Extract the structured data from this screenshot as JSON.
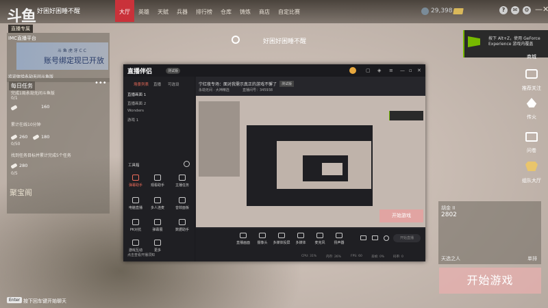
{
  "topbar": {
    "logo": "斗鱼",
    "logo_sub": "直播专属",
    "room_title": "好困好困睡不醒",
    "nav": [
      "大厅",
      "英雄",
      "天赋",
      "兵器",
      "排行榜",
      "仓库",
      "铸炼",
      "商店",
      "自定比赛"
    ],
    "active_nav": "大厅",
    "coins": "29,398",
    "icons": [
      "help-icon",
      "mail-icon",
      "settings-icon"
    ],
    "win_controls": [
      "—",
      "✕"
    ]
  },
  "left": {
    "banner_title": "IMC直播平台",
    "banner_small": "斗 鱼   虎 牙   C C",
    "banner_big": "账号绑定现已开放",
    "banner_caption": "欢迎体验永劫无间斗鱼版",
    "tasks_title": "每日任务",
    "tasks_more": "•••",
    "task_lines": [
      "完成1局永劫无间斗鱼版",
      "累计在线10分钟",
      "累计击败10名",
      "0/50",
      "找到任务目标并累计完成5个任务",
      "0/5"
    ],
    "task_nums": [
      "160",
      "260",
      "180",
      "280"
    ],
    "task_counts": [
      "0/1",
      "0/50",
      "0/5"
    ],
    "treasury": "聚宝阁"
  },
  "center": {
    "caption": "好困好困睡不醒"
  },
  "nvidia": {
    "text": "按下 Alt+Z，使用 GeForce Experience 游戏内覆盖"
  },
  "right": {
    "items": [
      "商城",
      "推荐关注",
      "传火",
      "问卷",
      "组队大厅"
    ],
    "party_label": "胡金 II",
    "party_score": "2802",
    "party_name": "天选之人",
    "party_mode": "单排",
    "start": "开始游戏",
    "enter_key": "Enter",
    "enter_text": "按下回车键开始聊天"
  },
  "stream": {
    "app": "直播伴侣",
    "badge": "测试版",
    "subtitle": "宁红夜专场：面对我需示真正的游戏不懈了",
    "room_info": "永劫无间 · 大神精选",
    "id": "直播间号：345938",
    "tabs": [
      "场景列表",
      "直播",
      "可选设"
    ],
    "scenes": [
      "直播画面 1",
      "直播画面 2",
      "Wonders",
      "游戏 1"
    ],
    "tools_title": "工具箱",
    "tools": [
      "弹幕助手",
      "观看助手",
      "主播任务",
      "电脑直播",
      "多人连麦",
      "音效面板",
      "PK对抗",
      "弹幕展",
      "数据助手",
      "游戏互动",
      "更多"
    ],
    "bar_items": [
      "直播画面",
      "摄像头",
      "多媒体投屏",
      "多媒体",
      "麦克风",
      "扬声器"
    ],
    "start_live": "开始直播",
    "stats": [
      "CPU: 31%",
      "内存: 26%",
      "FPS: 60",
      "丢帧: 0%",
      "码率: 0"
    ],
    "footer": "点击查看开播须知"
  }
}
